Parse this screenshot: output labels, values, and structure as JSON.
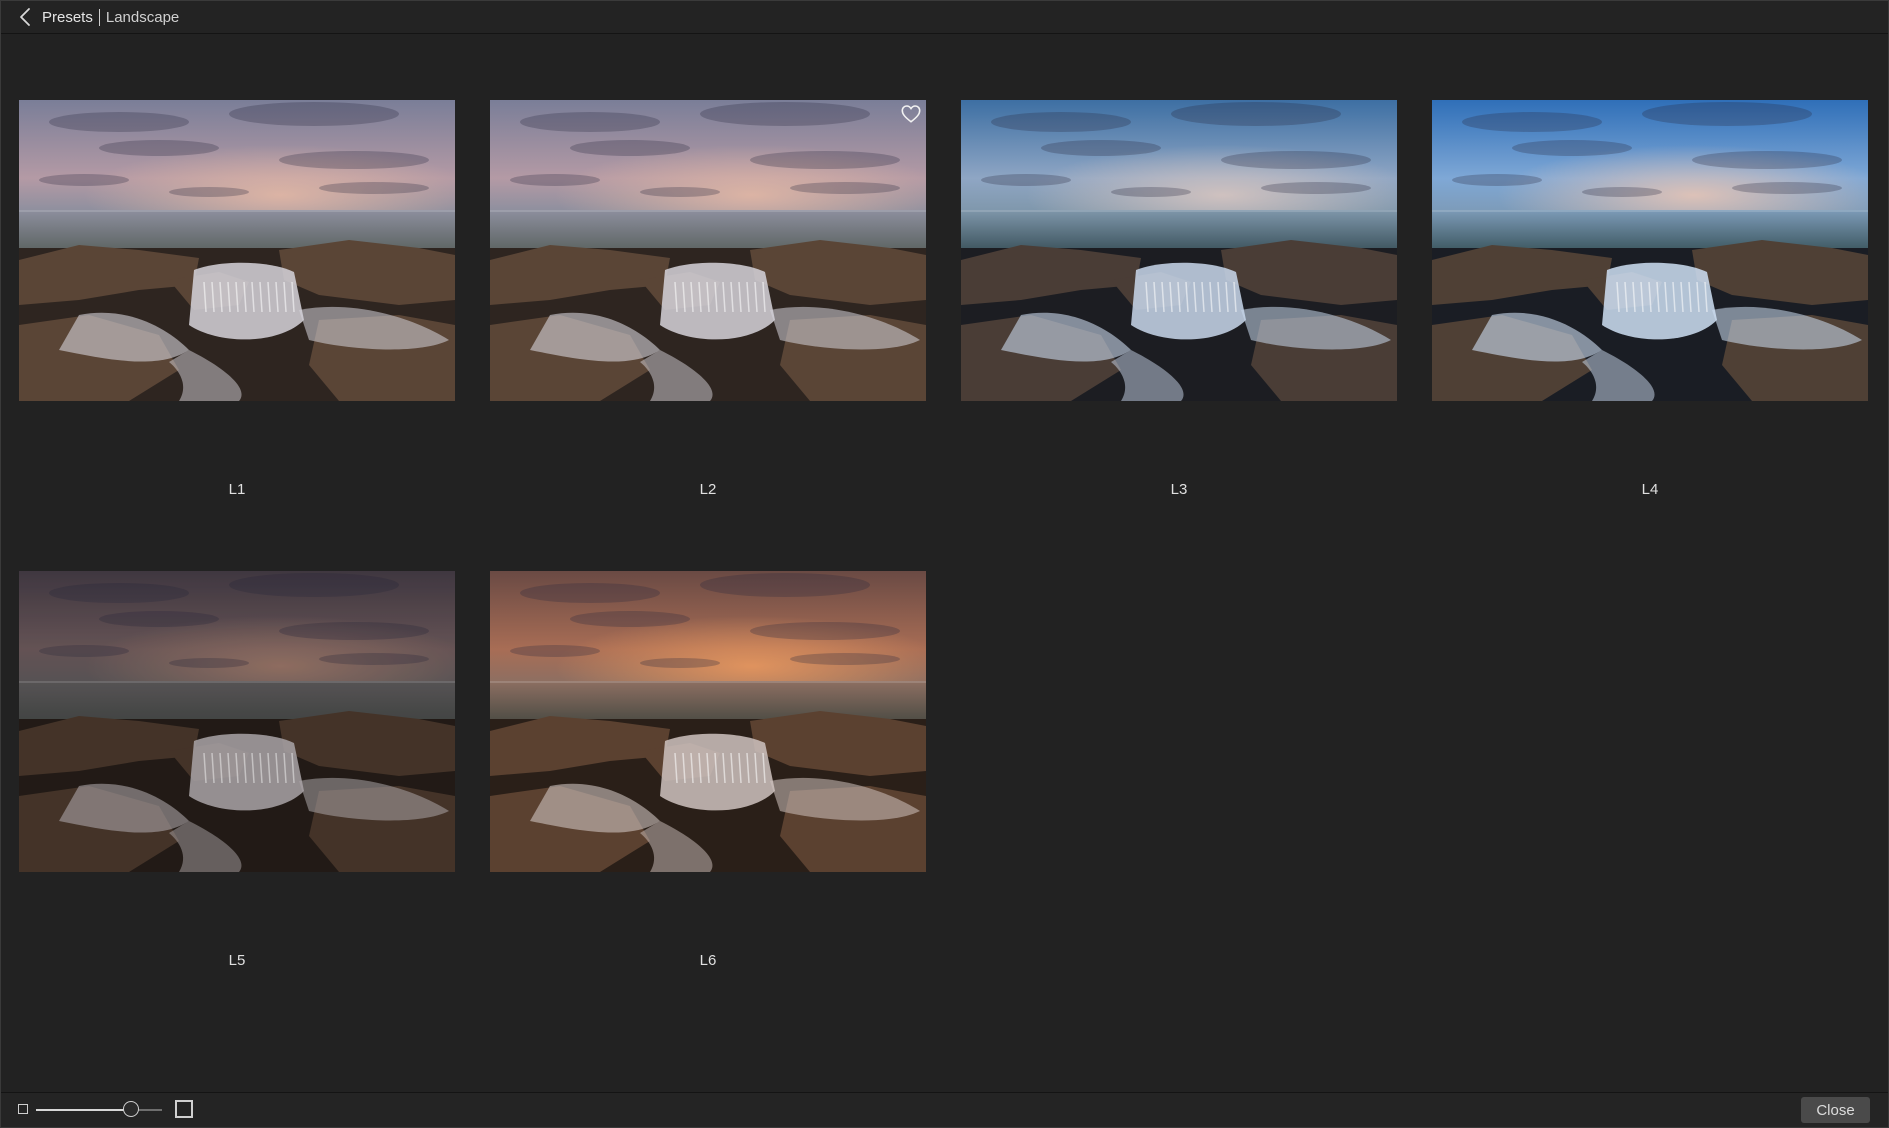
{
  "header": {
    "back_icon": "chevron-left-icon",
    "breadcrumb_root": "Presets",
    "breadcrumb_current": "Landscape"
  },
  "presets": [
    {
      "label": "L1",
      "favorite": false,
      "tone": "neutral-lavender"
    },
    {
      "label": "L2",
      "favorite": true,
      "tone": "neutral-lavender"
    },
    {
      "label": "L3",
      "favorite": false,
      "tone": "cool-blue"
    },
    {
      "label": "L4",
      "favorite": false,
      "tone": "vivid-blue"
    },
    {
      "label": "L5",
      "favorite": false,
      "tone": "dark-moody"
    },
    {
      "label": "L6",
      "favorite": false,
      "tone": "warm-orange"
    }
  ],
  "footer": {
    "thumb_size_slider": 0.75,
    "close_label": "Close",
    "small_icon": "small-thumbnail-icon",
    "large_icon": "large-thumbnail-icon"
  },
  "colors": {
    "background": "#222222",
    "header": "#232323",
    "text": "#e0e0e0",
    "button": "#4a4a4a"
  }
}
